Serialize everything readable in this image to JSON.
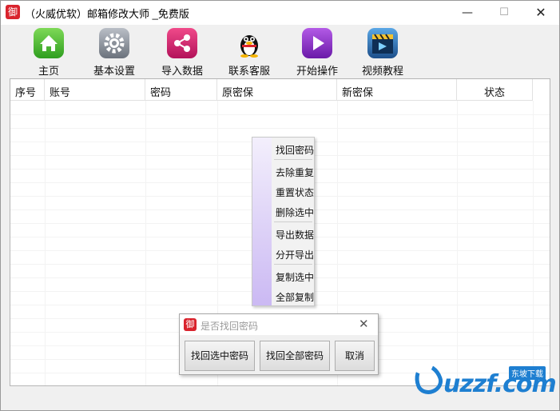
{
  "window": {
    "title": "（火威优软）邮箱修改大师 _免费版",
    "app_icon_glyph": "御",
    "minimize_glyph": "—",
    "maximize_glyph": "☐",
    "close_glyph": "✕"
  },
  "toolbar": {
    "items": [
      {
        "label": "主页",
        "icon": "home-icon"
      },
      {
        "label": "基本设置",
        "icon": "gear-icon"
      },
      {
        "label": "导入数据",
        "icon": "share-icon"
      },
      {
        "label": "联系客服",
        "icon": "qq-penguin-icon"
      },
      {
        "label": "开始操作",
        "icon": "play-icon"
      },
      {
        "label": "视频教程",
        "icon": "clapperboard-icon"
      }
    ]
  },
  "table": {
    "columns": [
      "序号",
      "账号",
      "密码",
      "原密保",
      "新密保",
      "状态"
    ]
  },
  "context_menu": {
    "items": [
      "找回密码",
      "去除重复",
      "重置状态",
      "删除选中",
      "导出数据",
      "分开导出",
      "复制选中",
      "全部复制"
    ]
  },
  "dialog": {
    "title": "是否找回密码",
    "icon_glyph": "御",
    "close_glyph": "✕",
    "buttons": [
      "找回选中密码",
      "找回全部密码",
      "取消"
    ]
  },
  "watermark": {
    "text": "uzzf.com",
    "badge": "东坡下载"
  },
  "colors": {
    "brand_red": "#d9232d",
    "watermark_blue": "#1e7fd1",
    "menu_gradient_end": "#cbb9f3"
  }
}
